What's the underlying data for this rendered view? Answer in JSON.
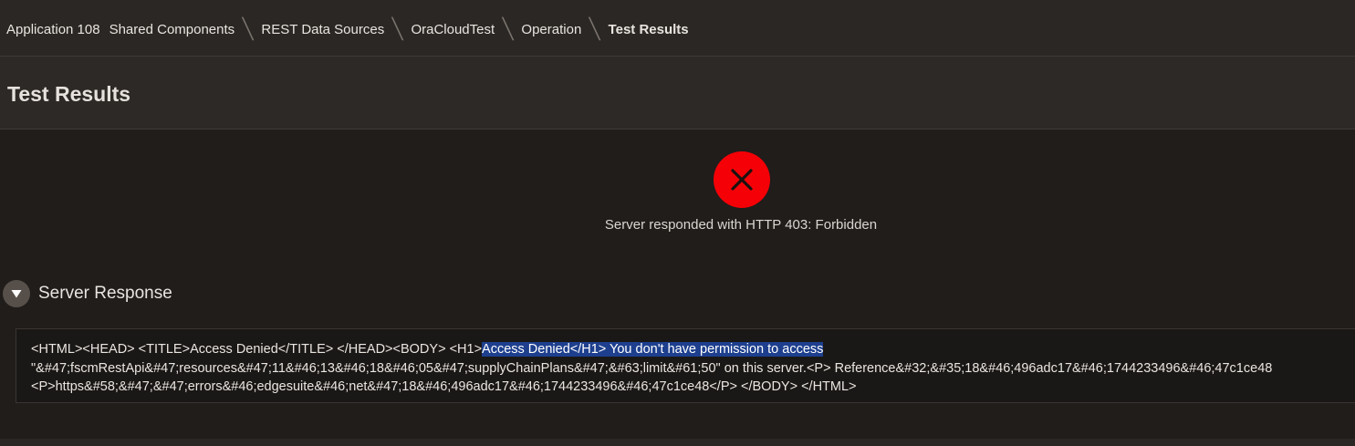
{
  "breadcrumb": {
    "items": [
      "Application 108",
      "Shared Components",
      "REST Data Sources",
      "OraCloudTest",
      "Operation",
      "Test Results"
    ]
  },
  "page": {
    "title": "Test Results"
  },
  "status": {
    "icon": "error-x-icon",
    "color": "#f50006",
    "message": "Server responded with HTTP 403: Forbidden"
  },
  "server_response": {
    "title": "Server Response",
    "body_before_selection": "<HTML><HEAD> <TITLE>Access Denied</TITLE> </HEAD><BODY> <H1>",
    "body_selected": "Access Denied</H1> You don't have permission to access",
    "body_after_selection": "\n\"&#47;fscmRestApi&#47;resources&#47;11&#46;13&#46;18&#46;05&#47;supplyChainPlans&#47;&#63;limit&#61;50\" on this server.<P> Reference&#32;&#35;18&#46;496adc17&#46;1744233496&#46;47c1ce48\n<P>https&#58;&#47;&#47;errors&#46;edgesuite&#46;net&#47;18&#46;496adc17&#46;1744233496&#46;47c1ce48</P> </BODY> </HTML>"
  }
}
